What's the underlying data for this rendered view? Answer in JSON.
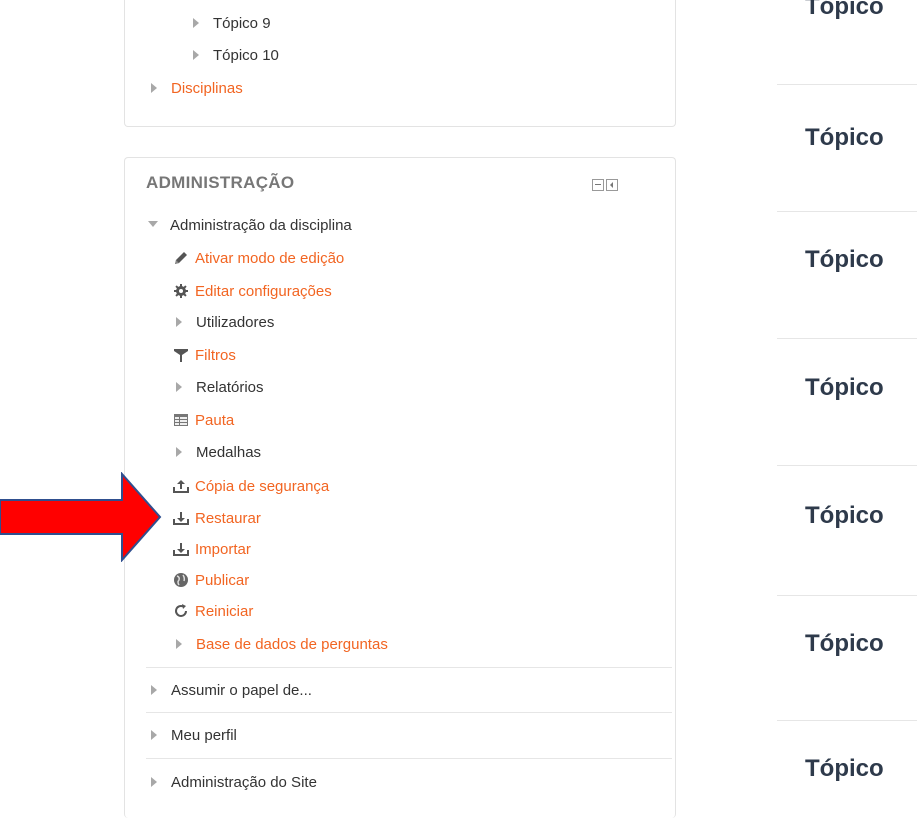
{
  "navigation": {
    "items": [
      {
        "label": "Tópico 9"
      },
      {
        "label": "Tópico 10"
      },
      {
        "label": "Disciplinas"
      }
    ]
  },
  "administration": {
    "title": "ADMINISTRAÇÃO",
    "course_admin": {
      "label": "Administração da disciplina",
      "items": [
        {
          "label": "Ativar modo de edição",
          "icon": "pencil-icon"
        },
        {
          "label": "Editar configurações",
          "icon": "gear-icon"
        },
        {
          "label": "Utilizadores",
          "icon": "expand-arrow-icon"
        },
        {
          "label": "Filtros",
          "icon": "filter-icon"
        },
        {
          "label": "Relatórios",
          "icon": "expand-arrow-icon"
        },
        {
          "label": "Pauta",
          "icon": "table-icon"
        },
        {
          "label": "Medalhas",
          "icon": "expand-arrow-icon"
        },
        {
          "label": "Cópia de segurança",
          "icon": "upload-icon"
        },
        {
          "label": "Restaurar",
          "icon": "download-icon"
        },
        {
          "label": "Importar",
          "icon": "download-icon"
        },
        {
          "label": "Publicar",
          "icon": "globe-icon"
        },
        {
          "label": "Reiniciar",
          "icon": "refresh-icon"
        },
        {
          "label": "Base de dados de perguntas",
          "icon": "expand-arrow-icon"
        }
      ]
    },
    "sections": [
      {
        "label": "Assumir o papel de..."
      },
      {
        "label": "Meu perfil"
      },
      {
        "label": "Administração do Site"
      }
    ]
  },
  "topics": [
    {
      "label": "Tópico"
    },
    {
      "label": "Tópico"
    },
    {
      "label": "Tópico"
    },
    {
      "label": "Tópico"
    },
    {
      "label": "Tópico"
    },
    {
      "label": "Tópico"
    },
    {
      "label": "Tópico"
    }
  ],
  "colors": {
    "link": "#f26522",
    "text": "#333333",
    "topic_heading": "#2e3a4b",
    "arrow_fill": "#ff0000",
    "arrow_stroke": "#2f4f8f"
  }
}
